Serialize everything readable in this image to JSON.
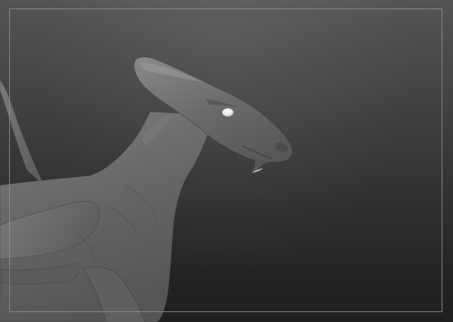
{
  "viewport": {
    "background_top": "#545454",
    "background_bottom": "#1f1f1f",
    "frame_color": "#8a8a8a"
  },
  "model": {
    "material_color": "#6b6b6b",
    "highlight_color": "#8e8e8e",
    "shadow_color": "#3f3f3f",
    "eye_color": "#f2f2f2"
  }
}
